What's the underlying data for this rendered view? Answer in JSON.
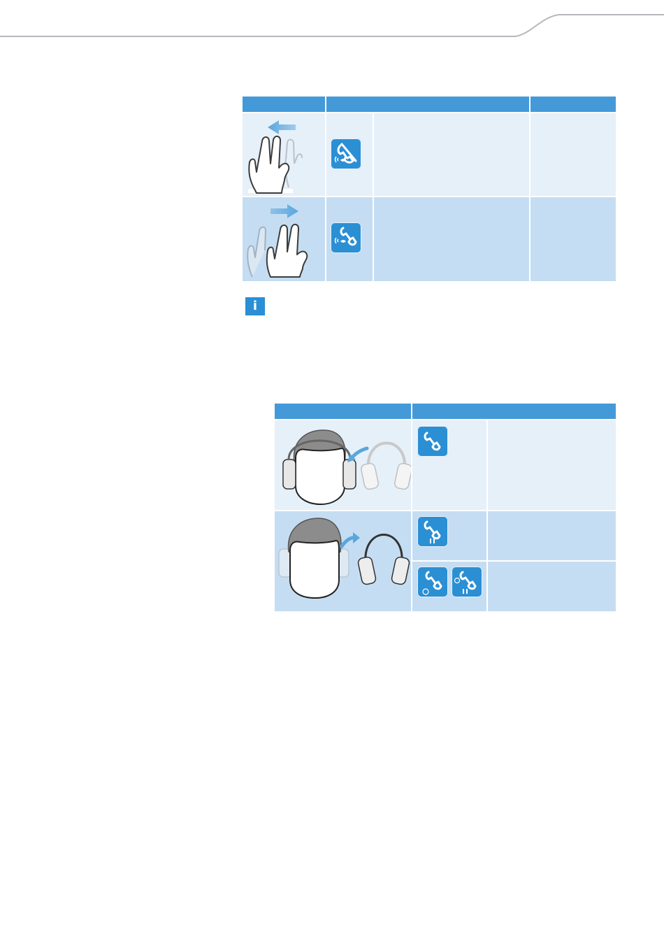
{
  "colors": {
    "header_blue": "#449ad8",
    "row_light": "#e6f0f9",
    "row_mid": "#c5ddf2",
    "icon_blue": "#2b8fd4"
  },
  "gesture_table": {
    "rows": [
      {
        "gesture": "two-finger-swipe-left",
        "icon": "reject-call-icon"
      },
      {
        "gesture": "two-finger-swipe-right",
        "icon": "accept-call-icon"
      }
    ]
  },
  "info_note": {
    "icon": "info-icon",
    "glyph": "i"
  },
  "headset_table": {
    "rows": [
      {
        "illustration": "headset-put-on",
        "icons": [
          "call-icon"
        ]
      },
      {
        "illustration": "headset-take-off",
        "icons": [
          "call-hold-icon",
          "call-and-held-call-icon",
          "held-call-icon"
        ]
      }
    ]
  }
}
